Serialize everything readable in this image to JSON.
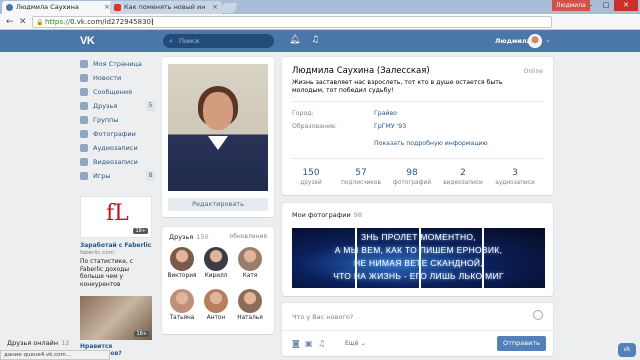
{
  "browser": {
    "tabs": [
      {
        "label": "Людмила Саухина",
        "active": true
      },
      {
        "label": "Как поменять новый ин",
        "active": false
      }
    ],
    "user_chip": "Людмила",
    "url_proto": "https://",
    "url_rest": "0.vk.com/id272945830",
    "status": "дание queue4.vk.com..."
  },
  "header": {
    "logo": "VK",
    "search_placeholder": "Поиск",
    "user_name": "Людмила"
  },
  "sidebar": {
    "items": [
      {
        "label": "Моя Страница",
        "count": ""
      },
      {
        "label": "Новости",
        "count": ""
      },
      {
        "label": "Сообщения",
        "count": ""
      },
      {
        "label": "Друзья",
        "count": "5"
      },
      {
        "label": "Группы",
        "count": ""
      },
      {
        "label": "Фотографии",
        "count": ""
      },
      {
        "label": "Аудиозаписи",
        "count": ""
      },
      {
        "label": "Видеозаписи",
        "count": ""
      },
      {
        "label": "Игры",
        "count": "8"
      }
    ]
  },
  "ads": {
    "logo_text": "fL",
    "age": "18+",
    "title": "Заработай с Faberlic",
    "domain": "faberlic.com",
    "text": "По статистике, с Faberlic доходы больше чем у конкурентов",
    "age2": "18+",
    "title2": "Нравится Тажегидов?"
  },
  "profile": {
    "edit_button": "Редактировать",
    "name": "Людмила Саухина (Залесская)",
    "online": "Online",
    "status": "Жизнь заставляет нас взрослеть, тот кто в душе остается быть молодым, тот победил судьбу!",
    "city_label": "Город:",
    "city": "Грайво",
    "edu_label": "Образование:",
    "edu": "ГрГМУ '93",
    "more": "Показать подробную информацию",
    "counters": [
      {
        "num": "150",
        "label": "друзей"
      },
      {
        "num": "57",
        "label": "подписчиков"
      },
      {
        "num": "98",
        "label": "фотографий"
      },
      {
        "num": "2",
        "label": "видеозаписи"
      },
      {
        "num": "3",
        "label": "аудиозаписи"
      }
    ]
  },
  "friends": {
    "title": "Друзья",
    "count": "150",
    "updates": "обновления",
    "list": [
      {
        "name": "Виктория",
        "color": "#7a5a4a"
      },
      {
        "name": "Кирилл",
        "color": "#3c3c44"
      },
      {
        "name": "Катя",
        "color": "#9a7d6a"
      },
      {
        "name": "Татьяна",
        "color": "#c08f7a"
      },
      {
        "name": "Антон",
        "color": "#b57e5e"
      },
      {
        "name": "Наталья",
        "color": "#8c6b58"
      }
    ],
    "online_title": "Друзья онлайн",
    "online_count": "12"
  },
  "photos": {
    "title": "Мои фотографии",
    "count": "98",
    "lines": [
      "ЗНЬ ПРОЛЕТ МОМЕНТНО,",
      "А МЫ ВЕМ, КАК ТО ПИШЕМ ЕРНОВИК,",
      "НЕ НИМАЯ ВЕТЕ СКАНДНОЙ,",
      "ЧТО НА ЖИЗНЬ - ЕГО ЛИШЬ ЛЬКО МИГ"
    ]
  },
  "post": {
    "placeholder": "Что у Вас нового?",
    "more": "Ещё",
    "send": "Отправить"
  },
  "colors": {
    "vk_blue": "#4a76a8",
    "link": "#2a5885",
    "button": "#5181b8"
  }
}
